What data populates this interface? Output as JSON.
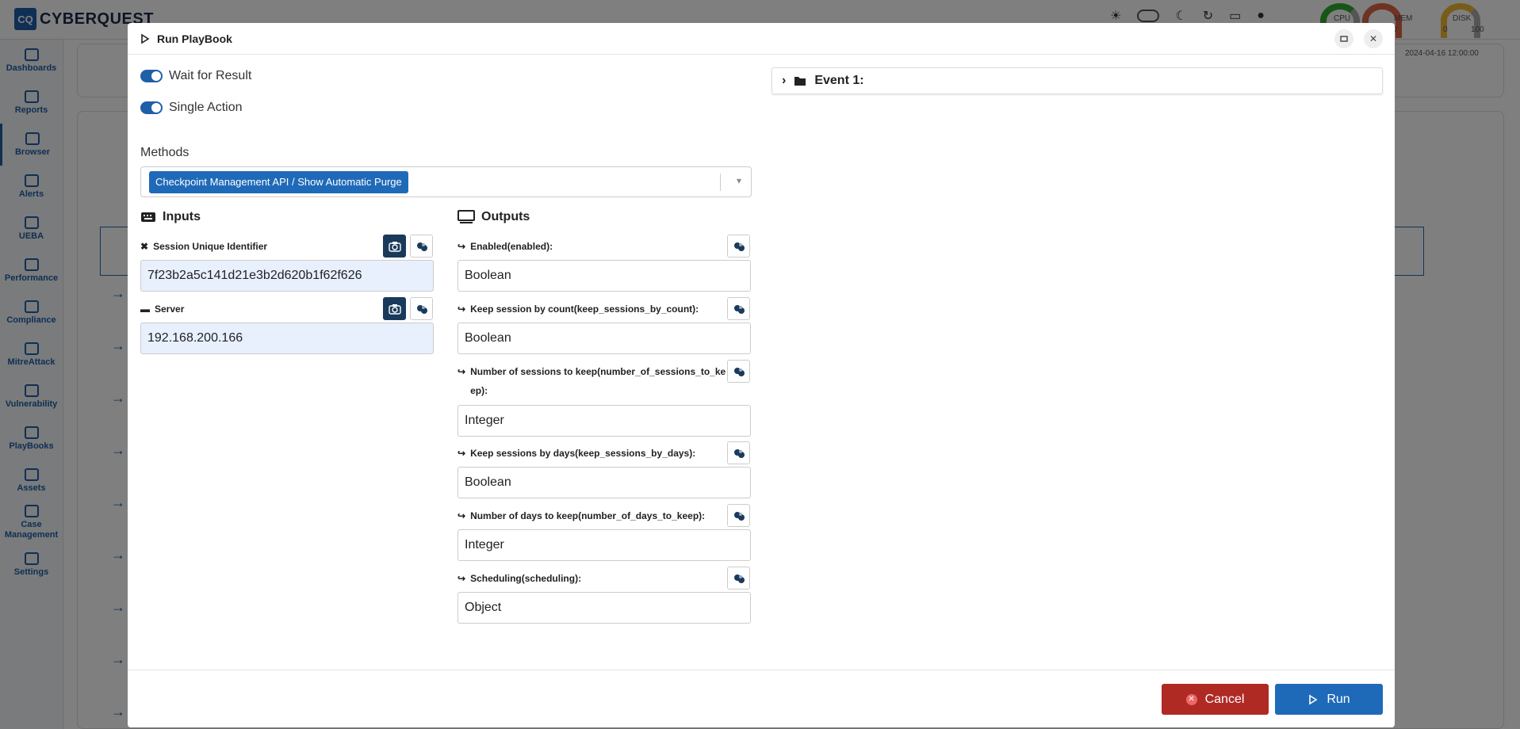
{
  "app": {
    "logo_badge": "CQ",
    "logo_text": "CYBERQUEST",
    "gauges": [
      "CPU",
      "MEM",
      "DISK"
    ],
    "gauge_ticks": [
      "100",
      "0",
      "100"
    ],
    "timeline_label": "2024-04-16 12:00:00"
  },
  "sidebar": {
    "items": [
      {
        "label": "Dashboards",
        "icon": "dashboard-icon"
      },
      {
        "label": "Reports",
        "icon": "filter-icon"
      },
      {
        "label": "Browser",
        "icon": "list-icon"
      },
      {
        "label": "Alerts",
        "icon": "bell-icon"
      },
      {
        "label": "UEBA",
        "icon": "chart-icon"
      },
      {
        "label": "Performance",
        "icon": "keyboard-icon"
      },
      {
        "label": "Compliance",
        "icon": "compliance-icon"
      },
      {
        "label": "MitreAttack",
        "icon": "command-icon"
      },
      {
        "label": "Vulnerability",
        "icon": "server-icon"
      },
      {
        "label": "PlayBooks",
        "icon": "playbook-icon"
      },
      {
        "label": "Assets",
        "icon": "laptop-icon"
      },
      {
        "label": "Case Management",
        "icon": "briefcase-icon"
      },
      {
        "label": "Settings",
        "icon": "gear-icon"
      }
    ]
  },
  "modal": {
    "title": "Run PlayBook",
    "toggles": {
      "wait_for_result": "Wait for Result",
      "single_action": "Single Action"
    },
    "methods_label": "Methods",
    "method_selected": "Checkpoint Management API / Show Automatic Purge",
    "inputs": {
      "heading": "Inputs",
      "fields": [
        {
          "label": "Session Unique Identifier",
          "value": "7f23b2a5c141d21e3b2d620b1f62f626"
        },
        {
          "label": "Server",
          "value": "192.168.200.166"
        }
      ]
    },
    "outputs": {
      "heading": "Outputs",
      "fields": [
        {
          "label": "Enabled(enabled):",
          "value": "Boolean"
        },
        {
          "label": "Keep session by count(keep_sessions_by_count):",
          "value": "Boolean"
        },
        {
          "label": "Number of sessions to keep(number_of_sessions_to_keep):",
          "value": "Integer"
        },
        {
          "label": "Keep sessions by days(keep_sessions_by_days):",
          "value": "Boolean"
        },
        {
          "label": "Number of days to keep(number_of_days_to_keep):",
          "value": "Integer"
        },
        {
          "label": "Scheduling(scheduling):",
          "value": "Object"
        }
      ]
    },
    "event_label": "Event 1:",
    "cancel_label": "Cancel",
    "run_label": "Run"
  },
  "colors": {
    "primary": "#1f6ab8",
    "danger": "#b02a24",
    "dark_button": "#1a3a5c"
  }
}
